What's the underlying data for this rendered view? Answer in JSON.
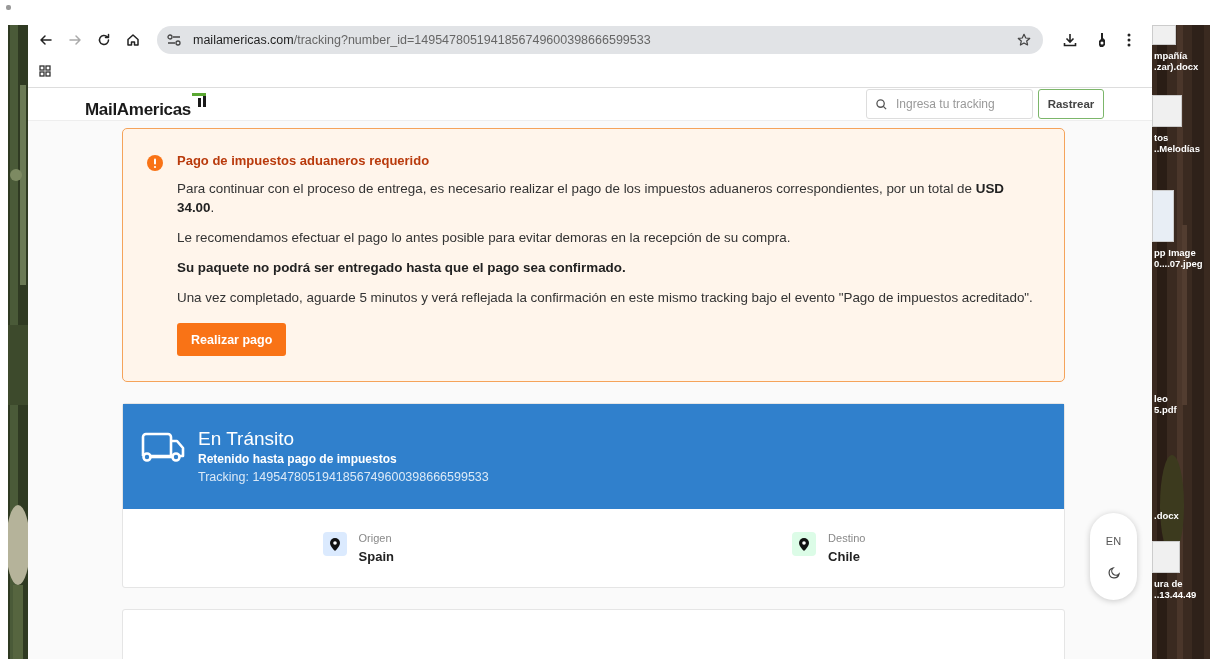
{
  "browser": {
    "nav_buttons": [
      {
        "kind": "back",
        "disabled": false
      },
      {
        "kind": "forward",
        "disabled": true
      },
      {
        "kind": "reload",
        "disabled": false
      },
      {
        "kind": "home",
        "disabled": false
      }
    ],
    "url": {
      "host": "mailamericas.com",
      "path": "/tracking?number_id=14954780519418567496003986665995​33"
    }
  },
  "page": {
    "header": {
      "logo": "MailAmericas",
      "search": {
        "placeholder": "Ingresa tu tracking"
      },
      "button": "Rastrear"
    },
    "alert": {
      "title": "Pago de impuestos aduaneros requerido",
      "paragraphs": [
        {
          "text": "Para continuar con el proceso de entrega, es necesario realizar el pago de los impuestos aduaneros correspondientes, por un total de **USD 34.00**.",
          "emphasis": false
        },
        {
          "text": "Le recomendamos efectuar el pago lo antes posible para evitar demoras en la recepción de su compra.",
          "emphasis": false
        },
        {
          "text": "Su paquete no podrá ser entregado hasta que el pago sea confirmado.",
          "emphasis": true
        },
        {
          "text": "Una vez completado, aguarde 5 minutos y verá reflejada la confirmación en este mismo tracking bajo el evento \"Pago de impuestos acreditado\".",
          "emphasis": false
        }
      ],
      "button": "Realizar pago"
    },
    "status": {
      "title": "En Tránsito",
      "subtitle": "Retenido hasta pago de impuestos",
      "tracking": "Tracking: 14954780519418567496003986665995​33"
    },
    "places": [
      {
        "label": "Origen",
        "value": "Spain",
        "color": "#dbeafe"
      },
      {
        "label": "Destino",
        "value": "Chile",
        "color": "#dcfce7"
      }
    ],
    "floating": {
      "language": "EN"
    }
  },
  "desktop": {
    "files": [
      {
        "lines": [
          "mpañía",
          ".zar).docx"
        ],
        "thumbnail": true
      },
      {
        "lines": [
          "tos",
          "..Melodías"
        ],
        "thumbnail": true
      },
      {
        "lines": [
          "pp Image",
          "0....07.jpeg"
        ],
        "thumbnail": true
      },
      {
        "lines": [
          "leo",
          "5.pdf"
        ],
        "thumbnail": false
      },
      {
        "lines": [
          ".docx"
        ],
        "thumbnail": false
      },
      {
        "lines": [
          "ura de",
          "..13.44.49"
        ],
        "thumbnail": true
      }
    ]
  }
}
